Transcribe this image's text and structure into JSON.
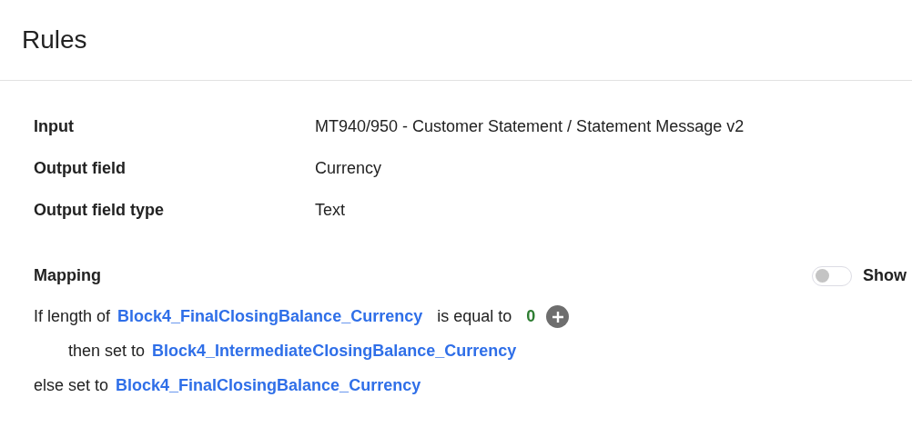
{
  "header": {
    "title": "Rules"
  },
  "details": [
    {
      "label": "Input",
      "value": "MT940/950 - Customer Statement / Statement Message v2"
    },
    {
      "label": "Output field",
      "value": "Currency"
    },
    {
      "label": "Output field type",
      "value": "Text"
    }
  ],
  "mapping": {
    "title": "Mapping",
    "toggle": {
      "on": false,
      "label": "Show"
    },
    "rules": [
      {
        "kind": "if",
        "prefix": "If length of",
        "field": "Block4_FinalClosingBalance_Currency",
        "operator": "is equal to",
        "value": "0"
      },
      {
        "kind": "then",
        "prefix": "then set to",
        "field": "Block4_IntermediateClosingBalance_Currency"
      },
      {
        "kind": "else",
        "prefix": "else set to",
        "field": "Block4_FinalClosingBalance_Currency"
      }
    ]
  }
}
